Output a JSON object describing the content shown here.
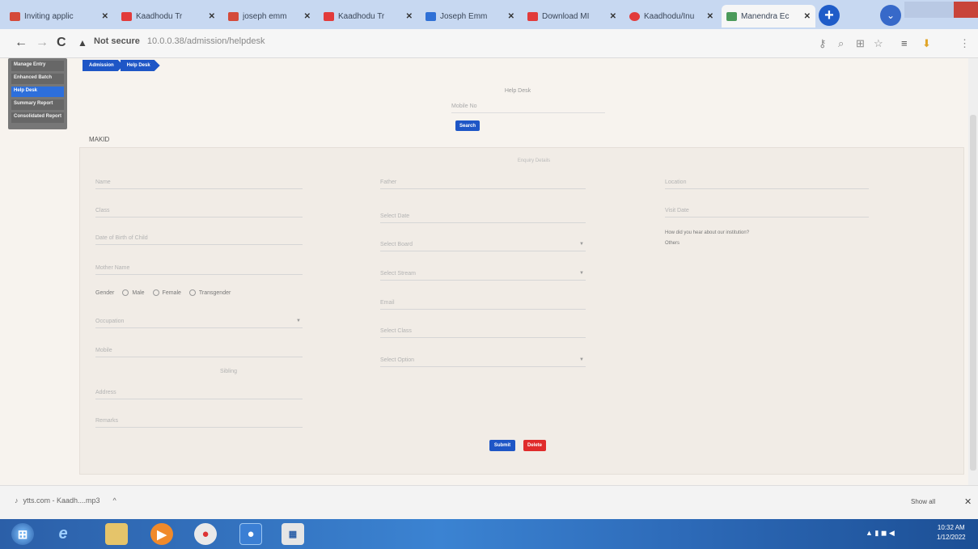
{
  "browser": {
    "tabs": [
      {
        "title": "Inviting applic",
        "color": "#d44a3a"
      },
      {
        "title": "Kaadhodu Tr",
        "color": "#e23b3b"
      },
      {
        "title": "joseph emm",
        "color": "#d44a3a"
      },
      {
        "title": "Kaadhodu Tr",
        "color": "#e23b3b"
      },
      {
        "title": "Joseph Emm",
        "color": "#2f70d6"
      },
      {
        "title": "Download MI",
        "color": "#e23b3b"
      },
      {
        "title": "Kaadhodu/Inu",
        "color": "#e23b3b"
      },
      {
        "title": "Manendra Ec",
        "color": "#4b9a5a"
      }
    ],
    "url": "10.0.0.38/admission/helpdesk",
    "security": "Not secure"
  },
  "sidebar": {
    "items": [
      "Manage Entry",
      "Enhanced Batch",
      "Help Desk",
      "Summary Report",
      "Consolidated Report"
    ],
    "active_index": 2
  },
  "breadcrumbs": [
    "Admission",
    "Help Desk"
  ],
  "page": {
    "title": "Help Desk",
    "search_placeholder": "Mobile No",
    "search_button": "Search",
    "section_label": "MAKID",
    "panel_header": "Enquiry Details"
  },
  "form": {
    "left_fields": [
      "Name",
      "Class",
      "Date of Birth of Child",
      "Mother Name",
      "Occupation",
      "Mobile",
      "Address",
      "Remarks"
    ],
    "gender_label": "Gender",
    "gender_options": [
      "Male",
      "Female",
      "Transgender"
    ],
    "middle_label": "Sibling",
    "middle_fields": [
      "Father",
      "Select Date",
      "Select Board",
      "Select Stream",
      "Email",
      "Select Class",
      "Select Option"
    ],
    "right_fields": [
      "Location",
      "Visit Date"
    ],
    "question": "How did you hear about our institution?",
    "question_value": "Others"
  },
  "actions": {
    "submit": "Submit",
    "delete": "Delete"
  },
  "downloads": {
    "file": "ytts.com - Kaadh....mp3",
    "show_all": "Show all"
  },
  "clock": {
    "time": "10:32 AM",
    "date": "1/12/2022"
  }
}
